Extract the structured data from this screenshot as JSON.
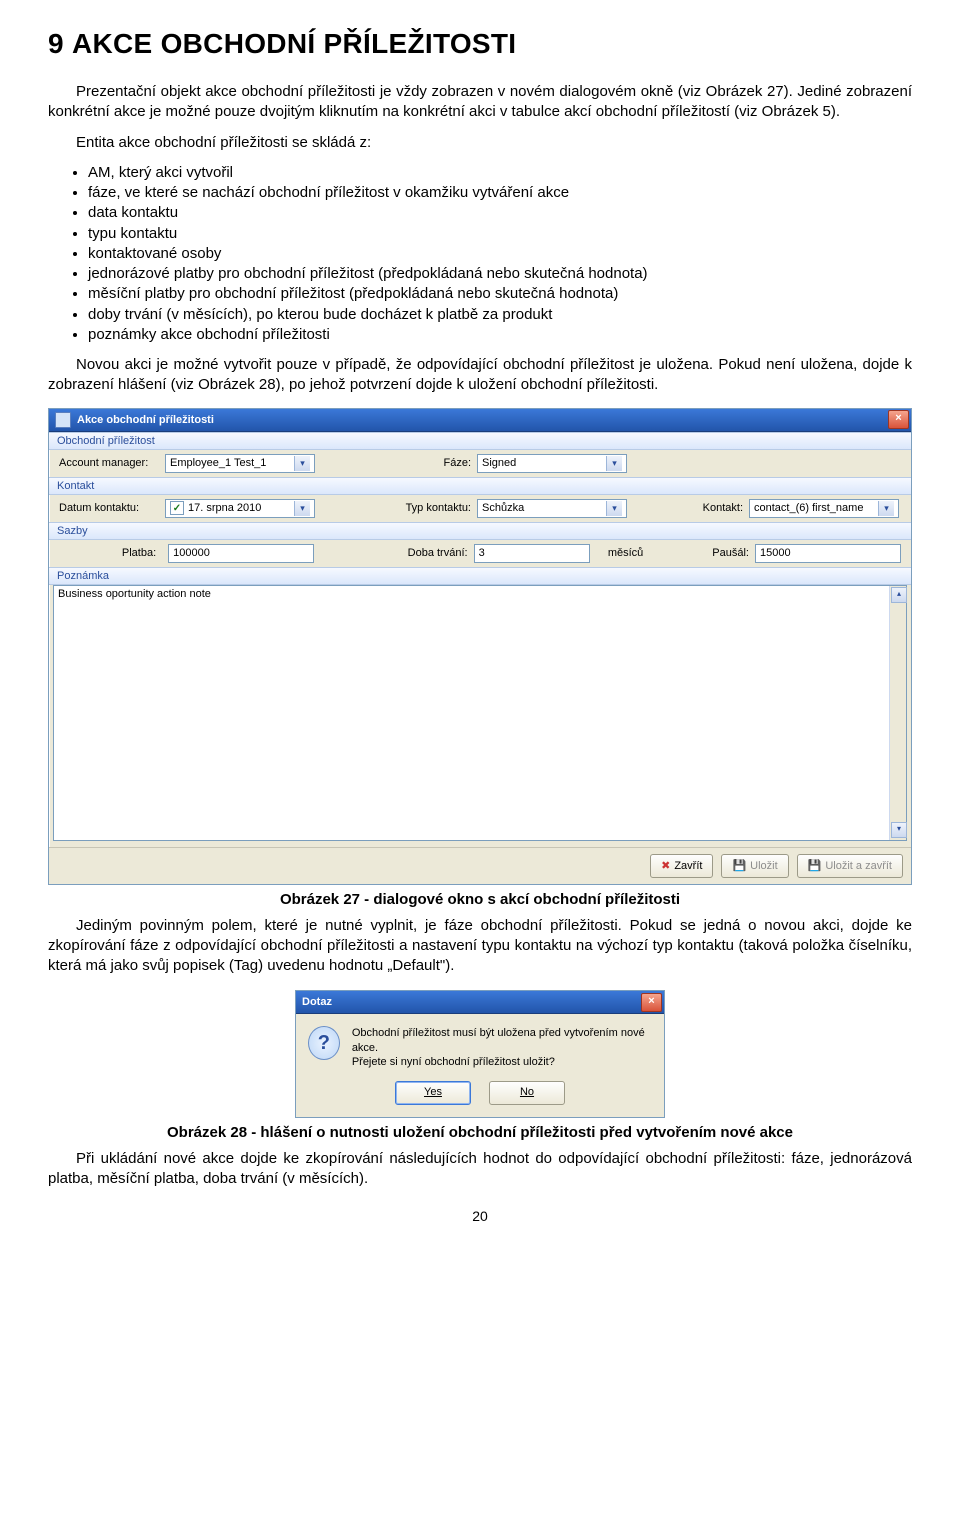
{
  "heading_num": "9",
  "heading_caps": "AKCE OBCHODNÍ PŘÍLEŽITOSTI",
  "p1": "Prezentační objekt akce obchodní příležitosti je vždy zobrazen v novém dialogovém okně (viz Obrázek 27). Jediné zobrazení konkrétní akce je možné pouze dvojitým kliknutím na konkrétní akci v tabulce akcí obchodní příležitostí (viz Obrázek 5).",
  "p2": "Entita akce obchodní příležitosti se skládá z:",
  "bullets": [
    "AM, který akci vytvořil",
    "fáze, ve které se nachází obchodní příležitost v okamžiku vytváření akce",
    "data kontaktu",
    "typu kontaktu",
    "kontaktované osoby",
    "jednorázové platby pro obchodní příležitost (předpokládaná nebo skutečná hodnota)",
    "měsíční platby pro obchodní příležitost (předpokládaná nebo skutečná hodnota)",
    "doby trvání (v měsících), po kterou bude docházet k platbě za produkt",
    "poznámky akce obchodní příležitosti"
  ],
  "p3": "Novou akci je možné vytvořit pouze v případě, že odpovídající obchodní příležitost je uložena. Pokud není uložena, dojde k zobrazení hlášení (viz Obrázek 28), po jehož potvrzení dojde k uložení obchodní příležitosti.",
  "caption27": "Obrázek 27 - dialogové okno s akcí obchodní příležitosti",
  "p4": "Jediným povinným polem, které je nutné vyplnit, je fáze obchodní příležitosti. Pokud se jedná o novou akci, dojde ke zkopírování fáze z odpovídající obchodní příležitosti a nastavení typu kontaktu na výchozí typ kontaktu (taková položka číselníku, která má jako svůj popisek (Tag) uvedenu hodnotu „Default\").",
  "caption28": "Obrázek 28 - hlášení o nutnosti uložení obchodní příležitosti před vytvořením nové akce",
  "p5": "Při ukládání nové akce dojde ke zkopírování následujících hodnot do odpovídající obchodní příležitosti: fáze, jednorázová platba, měsíční platba, doba trvání (v měsících).",
  "page_num": "20",
  "dlg": {
    "title": "Akce obchodní příležitosti",
    "groups": {
      "opp": "Obchodní příležitost",
      "kontakt": "Kontakt",
      "sazby": "Sazby",
      "pozn": "Poznámka"
    },
    "labels": {
      "am": "Account manager:",
      "faze": "Fáze:",
      "datum": "Datum kontaktu:",
      "typk": "Typ kontaktu:",
      "kontakt": "Kontakt:",
      "platba": "Platba:",
      "doba": "Doba trvání:",
      "mesicu": "měsíců",
      "pausal": "Paušál:"
    },
    "values": {
      "am": "Employee_1 Test_1",
      "faze": "Signed",
      "datum": "17.  srpna   2010",
      "typk": "Schůzka",
      "kontakt": "contact_(6) first_name",
      "platba": "100000",
      "doba": "3",
      "pausal": "15000",
      "note": "Business oportunity action note"
    },
    "buttons": {
      "close": "Zavřít",
      "save": "Uložit",
      "saveclose": "Uložit a zavřít"
    }
  },
  "msg": {
    "title": "Dotaz",
    "line1": "Obchodní příležitost musí být uložena před vytvořením nové akce.",
    "line2": "Přejete si nyní obchodní příležitost uložit?",
    "yes": "Yes",
    "no": "No"
  }
}
